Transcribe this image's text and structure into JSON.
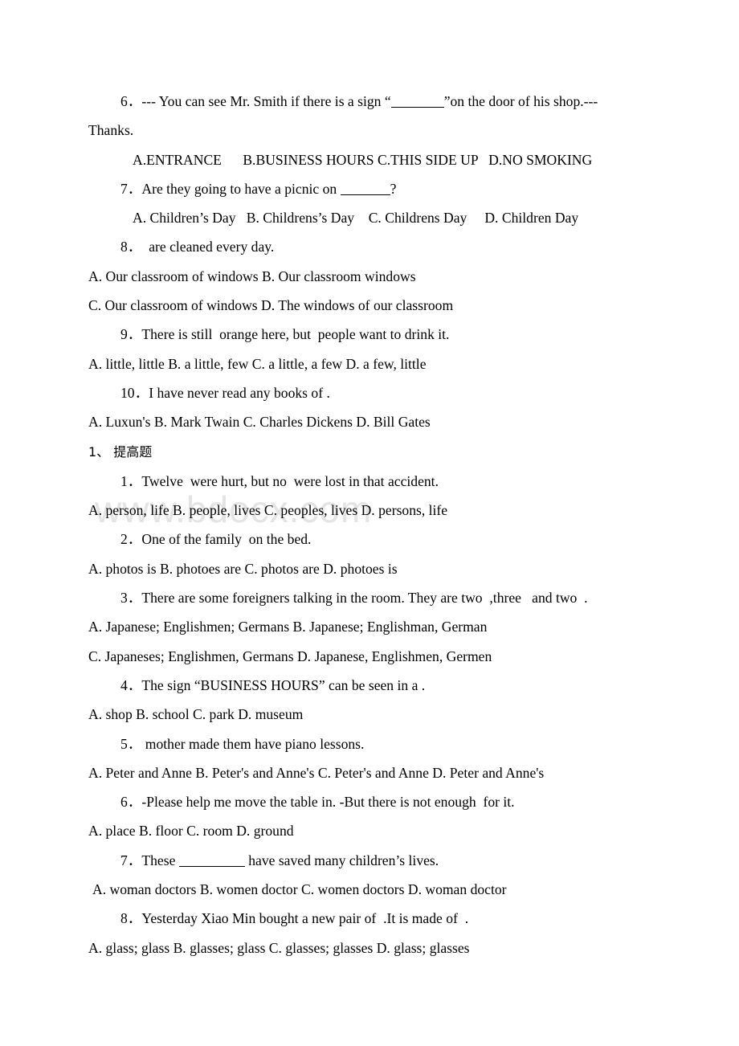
{
  "document": {
    "watermark": "www.bdocx.com",
    "lines": [
      {
        "id": "q6-stem",
        "name": "question-6-stem",
        "style": "q",
        "parts": [
          {
            "t": "6．--- You can see Mr. Smith if there is a sign “"
          },
          {
            "blank": "md"
          },
          {
            "t": "”on the door of his shop.---"
          }
        ]
      },
      {
        "id": "q6-stem-cont",
        "name": "question-6-stem-continued",
        "style": "cont",
        "text": "Thanks."
      },
      {
        "id": "q6-options",
        "name": "question-6-options",
        "style": "opt-indent",
        "text": "A.ENTRANCE      B.BUSINESS HOURS C.THIS SIDE UP   D.NO SMOKING"
      },
      {
        "id": "q7-stem",
        "name": "question-7-stem",
        "style": "q",
        "parts": [
          {
            "t": "7．Are they going to have a picnic on "
          },
          {
            "blank": "sm"
          },
          {
            "t": "?"
          }
        ]
      },
      {
        "id": "q7-options",
        "name": "question-7-options",
        "style": "opt-indent",
        "text": "A. Children’s Day   B. Childrens’s Day    C. Childrens Day     D. Children Day"
      },
      {
        "id": "q8-stem",
        "name": "question-8-stem",
        "style": "q",
        "text": "8．  are cleaned every day."
      },
      {
        "id": "q8-options-ab",
        "name": "question-8-options-ab",
        "style": "opt",
        "text": "A. Our classroom of windows B. Our classroom windows"
      },
      {
        "id": "q8-options-cd",
        "name": "question-8-options-cd",
        "style": "opt",
        "text": "C. Our classroom of windows D. The windows of our classroom"
      },
      {
        "id": "q9-stem",
        "name": "question-9-stem",
        "style": "q",
        "text": "9．There is still  orange here, but  people want to drink it."
      },
      {
        "id": "q9-options",
        "name": "question-9-options",
        "style": "opt",
        "text": "A. little, little B. a little, few C. a little, a few D. a few, little"
      },
      {
        "id": "q10-stem",
        "name": "question-10-stem",
        "style": "q",
        "text": "10．I have never read any books of ."
      },
      {
        "id": "q10-options",
        "name": "question-10-options",
        "style": "opt",
        "text": "A. Luxun's B. Mark Twain C. Charles Dickens D. Bill Gates"
      },
      {
        "id": "section-heading",
        "name": "section-heading-advanced-questions",
        "style": "heading",
        "text": "1、 提高题",
        "chinese": true
      },
      {
        "id": "a1-stem",
        "name": "advanced-question-1-stem",
        "style": "q",
        "text": "1．Twelve  were hurt, but no  were lost in that accident."
      },
      {
        "id": "a1-options",
        "name": "advanced-question-1-options",
        "style": "opt",
        "text": "A. person, life B. people, lives C. peoples, lives D. persons, life"
      },
      {
        "id": "a2-stem",
        "name": "advanced-question-2-stem",
        "style": "q",
        "text": "2．One of the family  on the bed."
      },
      {
        "id": "a2-options",
        "name": "advanced-question-2-options",
        "style": "opt",
        "text": "A. photos is B. photoes are C. photos are D. photoes is"
      },
      {
        "id": "a3-stem",
        "name": "advanced-question-3-stem",
        "style": "q",
        "text": "3．There are some foreigners talking in the room. They are two  ,three   and two  ."
      },
      {
        "id": "a3-options-ab",
        "name": "advanced-question-3-options-ab",
        "style": "opt",
        "text": "A. Japanese; Englishmen; Germans B. Japanese; Englishman, German"
      },
      {
        "id": "a3-options-cd",
        "name": "advanced-question-3-options-cd",
        "style": "opt",
        "text": "C. Japaneses; Englishmen, Germans D. Japanese, Englishmen, Germen"
      },
      {
        "id": "a4-stem",
        "name": "advanced-question-4-stem",
        "style": "q",
        "text": "4．The sign “BUSINESS HOURS” can be seen in a ."
      },
      {
        "id": "a4-options",
        "name": "advanced-question-4-options",
        "style": "opt",
        "text": "A. shop B. school C. park D. museum"
      },
      {
        "id": "a5-stem",
        "name": "advanced-question-5-stem",
        "style": "q",
        "text": "5． mother made them have piano lessons."
      },
      {
        "id": "a5-options",
        "name": "advanced-question-5-options",
        "style": "opt",
        "text": "A. Peter and Anne B. Peter's and Anne's C. Peter's and Anne D. Peter and Anne's"
      },
      {
        "id": "a6-stem",
        "name": "advanced-question-6-stem",
        "style": "q",
        "text": "6．-Please help me move the table in. -But there is not enough  for it."
      },
      {
        "id": "a6-options",
        "name": "advanced-question-6-options",
        "style": "opt",
        "text": "A. place B. floor C. room D. ground"
      },
      {
        "id": "a7-stem",
        "name": "advanced-question-7-stem",
        "style": "q",
        "parts": [
          {
            "t": "7．These "
          },
          {
            "blank": "lg"
          },
          {
            "t": " have saved many children’s lives."
          }
        ]
      },
      {
        "id": "a7-options",
        "name": "advanced-question-7-options",
        "style": "opt-indent-sm",
        "text": "A. woman doctors B. women doctor C. women doctors D. woman doctor"
      },
      {
        "id": "a8-stem",
        "name": "advanced-question-8-stem",
        "style": "q",
        "text": "8．Yesterday Xiao Min bought a new pair of  .It is made of  ."
      },
      {
        "id": "a8-options",
        "name": "advanced-question-8-options",
        "style": "opt",
        "text": "A. glass; glass B. glasses; glass C. glasses; glasses D. glass; glasses"
      }
    ]
  }
}
